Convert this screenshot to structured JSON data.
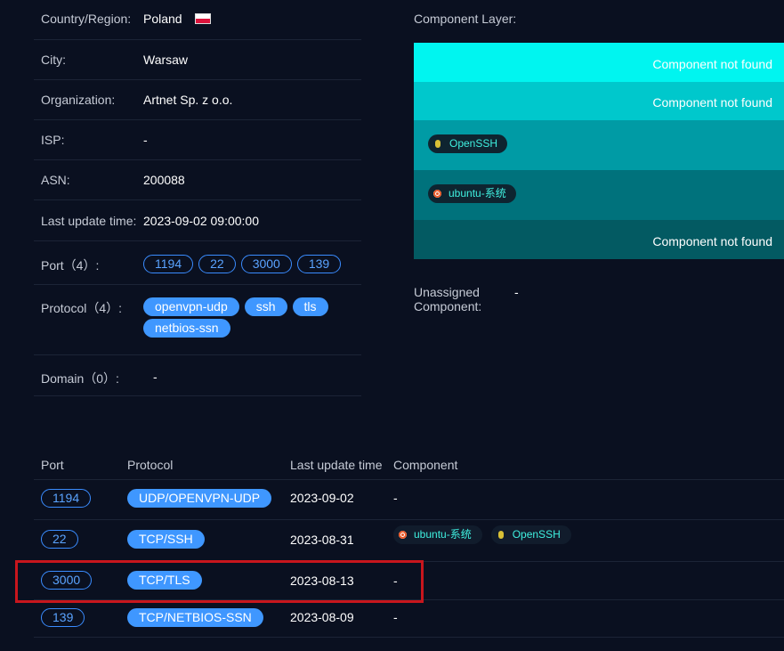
{
  "info": {
    "country_label": "Country/Region:",
    "country_value": "Poland",
    "city_label": "City:",
    "city_value": "Warsaw",
    "org_label": "Organization:",
    "org_value": "Artnet Sp. z o.o.",
    "isp_label": "ISP:",
    "isp_value": "-",
    "asn_label": "ASN:",
    "asn_value": "200088",
    "update_label": "Last update time:",
    "update_value": "2023-09-02 09:00:00",
    "port_label": "Port（4）:",
    "ports": [
      "1194",
      "22",
      "3000",
      "139"
    ],
    "protocol_label": "Protocol（4）:",
    "protocols": [
      "openvpn-udp",
      "ssh",
      "tls",
      "netbios-ssn"
    ],
    "domain_label": "Domain（0）:",
    "domain_value": "-"
  },
  "component_layer": {
    "title": "Component Layer:",
    "layers": [
      {
        "text": "Component not found",
        "color": "#00f5f0"
      },
      {
        "text": "Component not found",
        "color": "#00c8cc"
      },
      {
        "chip": "OpenSSH",
        "icon": "openssh-icon",
        "color": "#009ba5"
      },
      {
        "chip": "ubuntu-系统",
        "icon": "ubuntu-icon",
        "color": "#00727c"
      },
      {
        "text": "Component not found",
        "color": "#035a62"
      }
    ],
    "unassigned_label": "Unassigned Component:",
    "unassigned_value": "-"
  },
  "table": {
    "headers": [
      "Port",
      "Protocol",
      "Last update time",
      "Component"
    ],
    "rows": [
      {
        "port": "1194",
        "protocol": "UDP/OPENVPN-UDP",
        "time": "2023-09-02",
        "component": "-"
      },
      {
        "port": "22",
        "protocol": "TCP/SSH",
        "time": "2023-08-31",
        "components": [
          "ubuntu-系统",
          "OpenSSH"
        ]
      },
      {
        "port": "3000",
        "protocol": "TCP/TLS",
        "time": "2023-08-13",
        "component": "-",
        "highlighted": true
      },
      {
        "port": "139",
        "protocol": "TCP/NETBIOS-SSN",
        "time": "2023-08-09",
        "component": "-"
      }
    ]
  },
  "colors": {
    "background": "#0a1020",
    "accent_blue": "#3f97ff",
    "highlight_red": "#c8161d",
    "chip_text": "#3ff0e0"
  }
}
